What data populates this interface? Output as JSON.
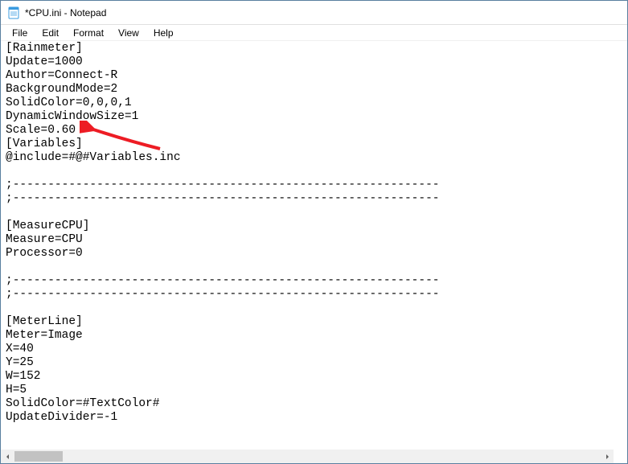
{
  "titlebar": {
    "title": "*CPU.ini - Notepad"
  },
  "menu": {
    "file": "File",
    "edit": "Edit",
    "format": "Format",
    "view": "View",
    "help": "Help"
  },
  "editor": {
    "content": "[Rainmeter]\nUpdate=1000\nAuthor=Connect-R\nBackgroundMode=2\nSolidColor=0,0,0,1\nDynamicWindowSize=1\nScale=0.60\n[Variables]\n@include=#@#Variables.inc\n\n;-------------------------------------------------------------\n;-------------------------------------------------------------\n\n[MeasureCPU]\nMeasure=CPU\nProcessor=0\n\n;-------------------------------------------------------------\n;-------------------------------------------------------------\n\n[MeterLine]\nMeter=Image\nX=40\nY=25\nW=152\nH=5\nSolidColor=#TextColor#\nUpdateDivider=-1"
  },
  "annotation": {
    "color": "#ED1C24"
  }
}
